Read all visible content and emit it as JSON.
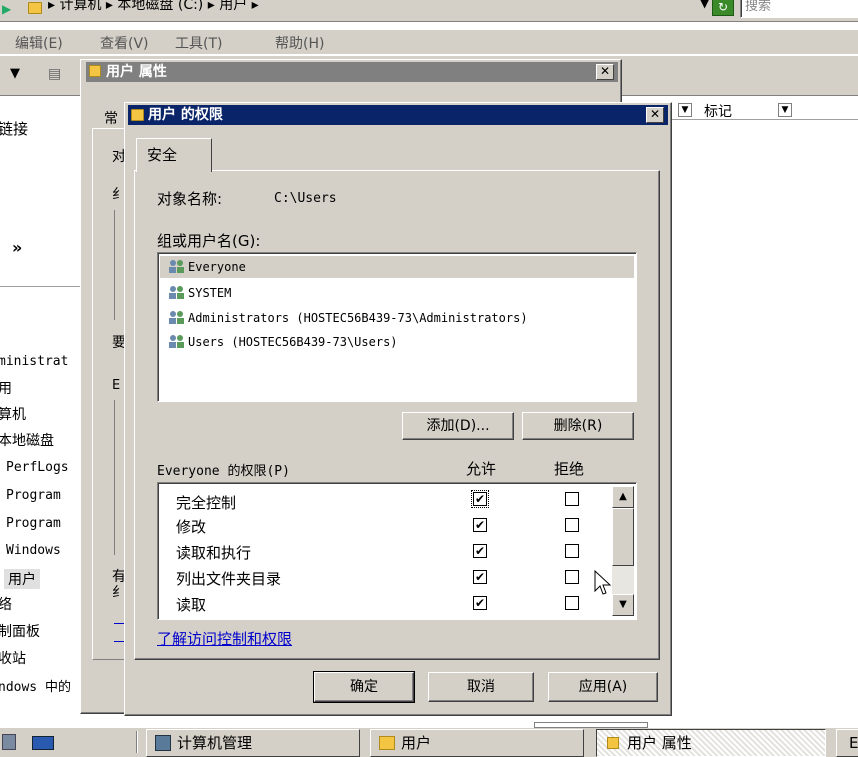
{
  "explorer": {
    "address_path": "▸ 计算机 ▸ 本地磁盘 (C:) ▸ 用户 ▸",
    "search_placeholder": "搜索",
    "menu": [
      "编辑(E)",
      "查看(V)",
      "工具(T)",
      "帮助(H)"
    ],
    "column_header": "标记",
    "left_pane": {
      "link": "链接",
      "more": "»",
      "tree": [
        "ministrat",
        "用",
        "算机",
        "本地磁盘",
        "PerfLogs",
        "Program",
        "Program",
        "Windows",
        "用户",
        "络",
        "制面板",
        "收站",
        "ndows 中的"
      ]
    }
  },
  "properties_dialog": {
    "title": "用户 属性",
    "partial_tab": "常",
    "partial_labels": [
      "对",
      "纟",
      "要",
      "E",
      "有",
      "纟"
    ]
  },
  "permissions_dialog": {
    "title": "用户 的权限",
    "tab": "安全",
    "object_label": "对象名称:",
    "object_value": "C:\\Users",
    "group_label": "组或用户名(G):",
    "users": [
      "Everyone",
      "SYSTEM",
      "Administrators (HOSTEC56B439-73\\Administrators)",
      "Users (HOSTEC56B439-73\\Users)"
    ],
    "add_button": "添加(D)...",
    "remove_button": "删除(R)",
    "perm_header": "Everyone 的权限(P)",
    "allow_header": "允许",
    "deny_header": "拒绝",
    "permissions": [
      {
        "name": "完全控制",
        "allow": true,
        "deny": false
      },
      {
        "name": "修改",
        "allow": true,
        "deny": false
      },
      {
        "name": "读取和执行",
        "allow": true,
        "deny": false
      },
      {
        "name": "列出文件夹目录",
        "allow": true,
        "deny": false
      },
      {
        "name": "读取",
        "allow": true,
        "deny": false
      }
    ],
    "learn_link": "了解访问控制和权限",
    "ok_button": "确定",
    "cancel_button": "取消",
    "apply_button": "应用(A)"
  },
  "taskbar": {
    "items": [
      "计算机管理",
      "用户",
      "用户 属性",
      "E"
    ]
  },
  "colors": {
    "title_active": "#0a246a",
    "title_inactive": "#808080",
    "face": "#d4d0c8",
    "selection": "#d4d0c8",
    "link": "#0000cc"
  }
}
